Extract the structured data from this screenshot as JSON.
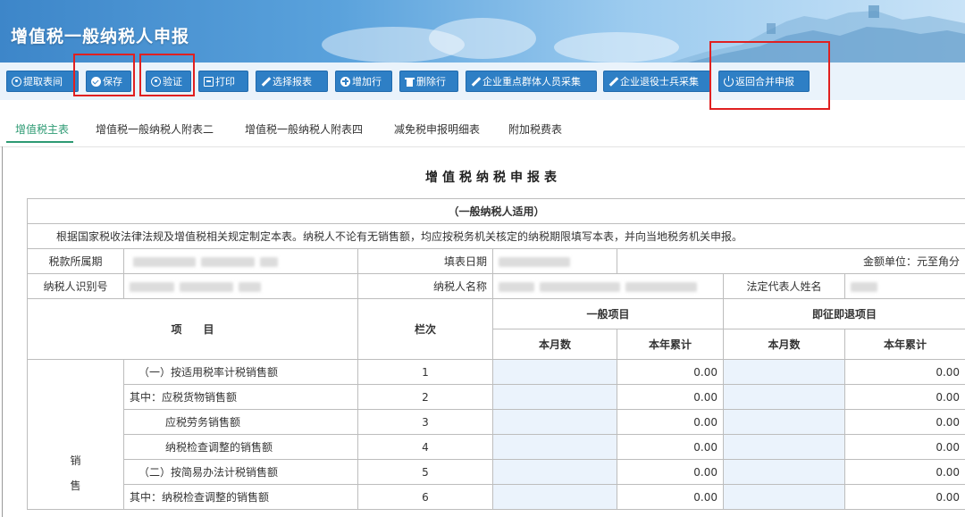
{
  "header": {
    "title": "增值税一般纳税人申报"
  },
  "toolbar": {
    "buttons": [
      "提取表间",
      "保存",
      "验证",
      "打印",
      "选择报表",
      "增加行",
      "删除行",
      "企业重点群体人员采集",
      "企业退役士兵采集",
      "返回合并申报"
    ]
  },
  "tabs": [
    "增值税主表",
    "增值税一般纳税人附表二",
    "增值税一般纳税人附表四",
    "减免税申报明细表",
    "附加税费表"
  ],
  "form": {
    "title": "增值税纳税申报表",
    "subtitle": "（一般纳税人适用）",
    "notice": "根据国家税收法律法规及增值税相关规定制定本表。纳税人不论有无销售额，均应按税务机关核定的纳税期限填写本表，并向当地税务机关申报。",
    "labels": {
      "period": "税款所属期",
      "fill_date": "填表日期",
      "unit": "金额单位：元至角分",
      "tax_id": "纳税人识别号",
      "taxpayer_name": "纳税人名称",
      "legal_rep": "法定代表人姓名"
    },
    "headers": {
      "item": "项　　目",
      "col": "栏次",
      "general": "一般项目",
      "refund": "即征即退项目",
      "month": "本月数",
      "ytd": "本年累计"
    },
    "section_chars": [
      "销",
      "售"
    ],
    "rows": [
      {
        "label": "（一）按适用税率计税销售额",
        "no": "1",
        "general_ytd": "0.00",
        "refund_ytd": "0.00"
      },
      {
        "label": "其中：应税货物销售额",
        "no": "2",
        "general_ytd": "0.00",
        "refund_ytd": "0.00"
      },
      {
        "label": "应税劳务销售额",
        "no": "3",
        "general_ytd": "0.00",
        "refund_ytd": "0.00"
      },
      {
        "label": "纳税检查调整的销售额",
        "no": "4",
        "general_ytd": "0.00",
        "refund_ytd": "0.00"
      },
      {
        "label": "（二）按简易办法计税销售额",
        "no": "5",
        "general_ytd": "0.00",
        "refund_ytd": "0.00"
      },
      {
        "label": "其中：纳税检查调整的销售额",
        "no": "6",
        "general_ytd": "0.00",
        "refund_ytd": "0.00"
      }
    ]
  }
}
